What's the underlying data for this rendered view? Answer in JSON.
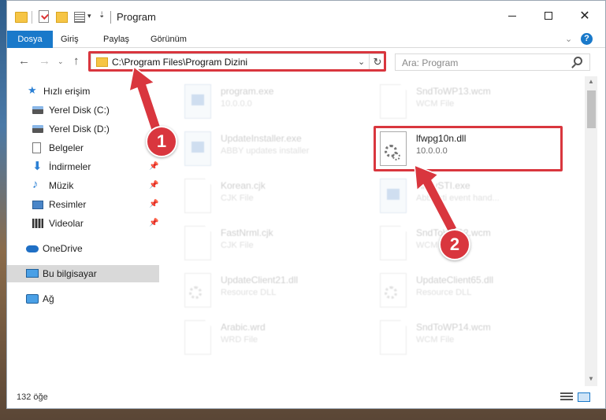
{
  "window": {
    "title": "Program",
    "controls": {
      "minimize": "",
      "maximize": "",
      "close": "✕"
    }
  },
  "ribbon": {
    "tabs": [
      "Dosya",
      "Giriş",
      "Paylaş",
      "Görünüm"
    ],
    "help": "?"
  },
  "nav": {
    "back": "←",
    "forward": "→",
    "up": "↑",
    "address": "C:\\Program Files\\Program Dizini",
    "refresh": "↻",
    "search_placeholder": "Ara: Program"
  },
  "sidebar": {
    "items": [
      {
        "label": "Hızlı erişim",
        "icon": "star-icon"
      },
      {
        "label": "Yerel Disk (C:)",
        "icon": "disk-icon"
      },
      {
        "label": "Yerel Disk (D:)",
        "icon": "disk-icon"
      },
      {
        "label": "Belgeler",
        "icon": "document-icon",
        "pinned": true
      },
      {
        "label": "İndirmeler",
        "icon": "download-icon",
        "pinned": true
      },
      {
        "label": "Müzik",
        "icon": "music-icon",
        "pinned": true
      },
      {
        "label": "Resimler",
        "icon": "picture-icon",
        "pinned": true
      },
      {
        "label": "Videolar",
        "icon": "video-icon",
        "pinned": true
      },
      {
        "label": "OneDrive",
        "icon": "cloud-icon"
      },
      {
        "label": "Bu bilgisayar",
        "icon": "computer-icon",
        "selected": true
      },
      {
        "label": "Ağ",
        "icon": "network-icon"
      }
    ]
  },
  "files": [
    {
      "name": "program.exe",
      "sub": "10.0.0.0",
      "type": "exe",
      "highlighted": false
    },
    {
      "name": "SndToWP13.wcm",
      "sub": "WCM File",
      "type": "page",
      "highlighted": false
    },
    {
      "name": "UpdateInstaller.exe",
      "sub": "ABBY updates installer",
      "type": "exe",
      "highlighted": false
    },
    {
      "name": "lfwpg10n.dll",
      "sub": "10.0.0.0",
      "type": "dll",
      "highlighted": true
    },
    {
      "name": "Korean.cjk",
      "sub": "CJK File",
      "type": "page",
      "highlighted": false
    },
    {
      "name": "AbbySTI.exe",
      "sub": "Abby sti event hand...",
      "type": "exe",
      "highlighted": false
    },
    {
      "name": "FastNrml.cjk",
      "sub": "CJK File",
      "type": "page",
      "highlighted": false
    },
    {
      "name": "SndToWP12.wcm",
      "sub": "WCM File",
      "type": "page",
      "highlighted": false
    },
    {
      "name": "UpdateClient21.dll",
      "sub": "Resource DLL",
      "type": "dll",
      "highlighted": false
    },
    {
      "name": "UpdateClient65.dll",
      "sub": "Resource DLL",
      "type": "dll",
      "highlighted": false
    },
    {
      "name": "Arabic.wrd",
      "sub": "WRD File",
      "type": "page",
      "highlighted": false
    },
    {
      "name": "SndToWP14.wcm",
      "sub": "WCM File",
      "type": "page",
      "highlighted": false
    }
  ],
  "status": {
    "item_count": "132 öğe"
  },
  "annotations": {
    "step1": "1",
    "step2": "2",
    "color": "#d9363e"
  },
  "colors": {
    "accent": "#1979ca",
    "highlight": "#d9363e"
  }
}
